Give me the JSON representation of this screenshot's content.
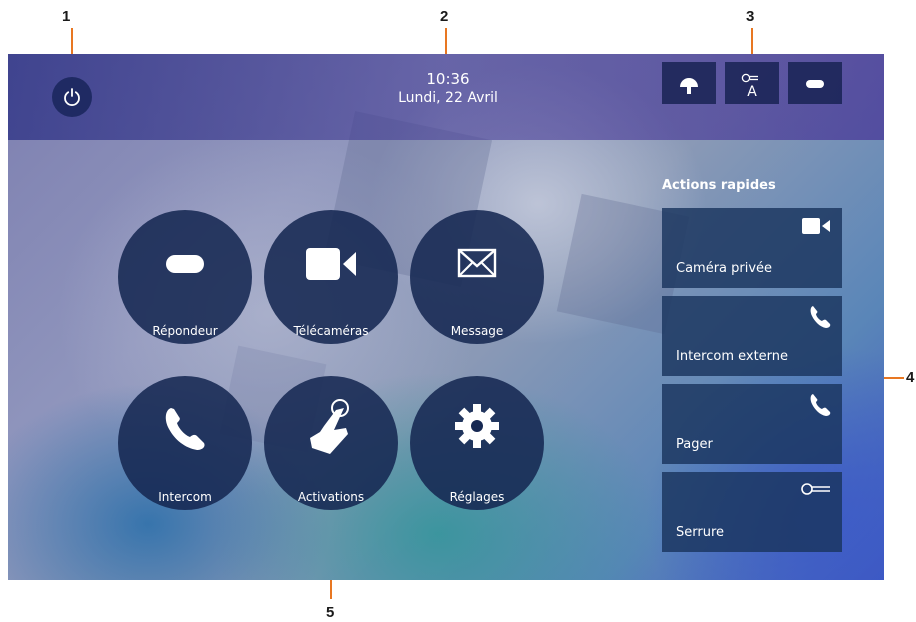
{
  "annotations": {
    "callouts": [
      "1",
      "2",
      "3",
      "4",
      "5"
    ]
  },
  "header": {
    "time": "10:36",
    "date": "Lundi, 22 Avril",
    "status_icons": [
      "bell-off-icon",
      "key-auto-icon",
      "voicemail-icon"
    ],
    "status_labels": {
      "auto_text": "A"
    }
  },
  "quick_actions": {
    "title": "Actions rapides",
    "items": [
      {
        "label": "Caméra privée",
        "icon": "video-camera-icon"
      },
      {
        "label": "Intercom externe",
        "icon": "phone-icon"
      },
      {
        "label": "Pager",
        "icon": "phone-icon"
      },
      {
        "label": "Serrure",
        "icon": "key-icon"
      }
    ]
  },
  "apps": [
    {
      "label": "Répondeur",
      "icon": "voicemail-icon"
    },
    {
      "label": "Télécaméras",
      "icon": "video-camera-icon"
    },
    {
      "label": "Message",
      "icon": "envelope-icon"
    },
    {
      "label": "Intercom",
      "icon": "phone-icon"
    },
    {
      "label": "Activations",
      "icon": "hand-touch-icon"
    },
    {
      "label": "Réglages",
      "icon": "gear-icon"
    }
  ],
  "colors": {
    "accent_orange": "#e87722",
    "tile_navy": "#1a345e",
    "power_button": "#1f2a63"
  }
}
